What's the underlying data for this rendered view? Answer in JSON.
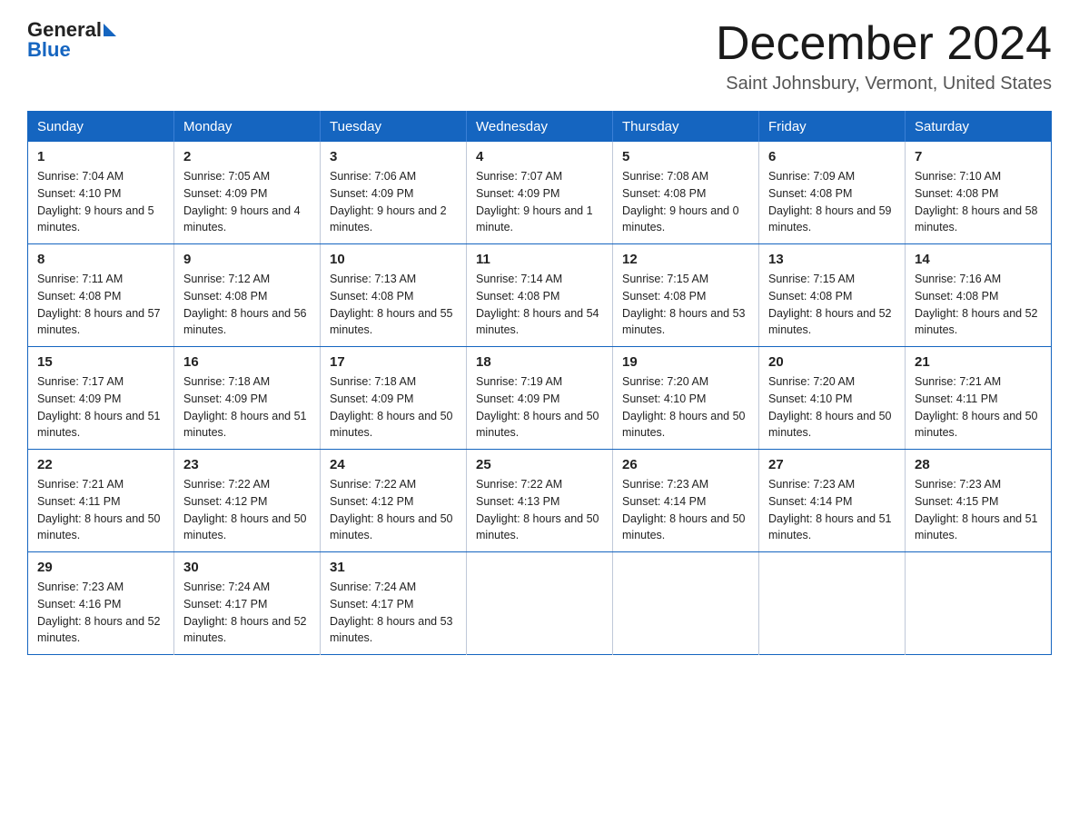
{
  "logo": {
    "general": "General",
    "blue": "Blue"
  },
  "title": {
    "month": "December 2024",
    "location": "Saint Johnsbury, Vermont, United States"
  },
  "headers": [
    "Sunday",
    "Monday",
    "Tuesday",
    "Wednesday",
    "Thursday",
    "Friday",
    "Saturday"
  ],
  "weeks": [
    [
      {
        "day": "1",
        "sunrise": "7:04 AM",
        "sunset": "4:10 PM",
        "daylight": "9 hours and 5 minutes."
      },
      {
        "day": "2",
        "sunrise": "7:05 AM",
        "sunset": "4:09 PM",
        "daylight": "9 hours and 4 minutes."
      },
      {
        "day": "3",
        "sunrise": "7:06 AM",
        "sunset": "4:09 PM",
        "daylight": "9 hours and 2 minutes."
      },
      {
        "day": "4",
        "sunrise": "7:07 AM",
        "sunset": "4:09 PM",
        "daylight": "9 hours and 1 minute."
      },
      {
        "day": "5",
        "sunrise": "7:08 AM",
        "sunset": "4:08 PM",
        "daylight": "9 hours and 0 minutes."
      },
      {
        "day": "6",
        "sunrise": "7:09 AM",
        "sunset": "4:08 PM",
        "daylight": "8 hours and 59 minutes."
      },
      {
        "day": "7",
        "sunrise": "7:10 AM",
        "sunset": "4:08 PM",
        "daylight": "8 hours and 58 minutes."
      }
    ],
    [
      {
        "day": "8",
        "sunrise": "7:11 AM",
        "sunset": "4:08 PM",
        "daylight": "8 hours and 57 minutes."
      },
      {
        "day": "9",
        "sunrise": "7:12 AM",
        "sunset": "4:08 PM",
        "daylight": "8 hours and 56 minutes."
      },
      {
        "day": "10",
        "sunrise": "7:13 AM",
        "sunset": "4:08 PM",
        "daylight": "8 hours and 55 minutes."
      },
      {
        "day": "11",
        "sunrise": "7:14 AM",
        "sunset": "4:08 PM",
        "daylight": "8 hours and 54 minutes."
      },
      {
        "day": "12",
        "sunrise": "7:15 AM",
        "sunset": "4:08 PM",
        "daylight": "8 hours and 53 minutes."
      },
      {
        "day": "13",
        "sunrise": "7:15 AM",
        "sunset": "4:08 PM",
        "daylight": "8 hours and 52 minutes."
      },
      {
        "day": "14",
        "sunrise": "7:16 AM",
        "sunset": "4:08 PM",
        "daylight": "8 hours and 52 minutes."
      }
    ],
    [
      {
        "day": "15",
        "sunrise": "7:17 AM",
        "sunset": "4:09 PM",
        "daylight": "8 hours and 51 minutes."
      },
      {
        "day": "16",
        "sunrise": "7:18 AM",
        "sunset": "4:09 PM",
        "daylight": "8 hours and 51 minutes."
      },
      {
        "day": "17",
        "sunrise": "7:18 AM",
        "sunset": "4:09 PM",
        "daylight": "8 hours and 50 minutes."
      },
      {
        "day": "18",
        "sunrise": "7:19 AM",
        "sunset": "4:09 PM",
        "daylight": "8 hours and 50 minutes."
      },
      {
        "day": "19",
        "sunrise": "7:20 AM",
        "sunset": "4:10 PM",
        "daylight": "8 hours and 50 minutes."
      },
      {
        "day": "20",
        "sunrise": "7:20 AM",
        "sunset": "4:10 PM",
        "daylight": "8 hours and 50 minutes."
      },
      {
        "day": "21",
        "sunrise": "7:21 AM",
        "sunset": "4:11 PM",
        "daylight": "8 hours and 50 minutes."
      }
    ],
    [
      {
        "day": "22",
        "sunrise": "7:21 AM",
        "sunset": "4:11 PM",
        "daylight": "8 hours and 50 minutes."
      },
      {
        "day": "23",
        "sunrise": "7:22 AM",
        "sunset": "4:12 PM",
        "daylight": "8 hours and 50 minutes."
      },
      {
        "day": "24",
        "sunrise": "7:22 AM",
        "sunset": "4:12 PM",
        "daylight": "8 hours and 50 minutes."
      },
      {
        "day": "25",
        "sunrise": "7:22 AM",
        "sunset": "4:13 PM",
        "daylight": "8 hours and 50 minutes."
      },
      {
        "day": "26",
        "sunrise": "7:23 AM",
        "sunset": "4:14 PM",
        "daylight": "8 hours and 50 minutes."
      },
      {
        "day": "27",
        "sunrise": "7:23 AM",
        "sunset": "4:14 PM",
        "daylight": "8 hours and 51 minutes."
      },
      {
        "day": "28",
        "sunrise": "7:23 AM",
        "sunset": "4:15 PM",
        "daylight": "8 hours and 51 minutes."
      }
    ],
    [
      {
        "day": "29",
        "sunrise": "7:23 AM",
        "sunset": "4:16 PM",
        "daylight": "8 hours and 52 minutes."
      },
      {
        "day": "30",
        "sunrise": "7:24 AM",
        "sunset": "4:17 PM",
        "daylight": "8 hours and 52 minutes."
      },
      {
        "day": "31",
        "sunrise": "7:24 AM",
        "sunset": "4:17 PM",
        "daylight": "8 hours and 53 minutes."
      },
      null,
      null,
      null,
      null
    ]
  ]
}
